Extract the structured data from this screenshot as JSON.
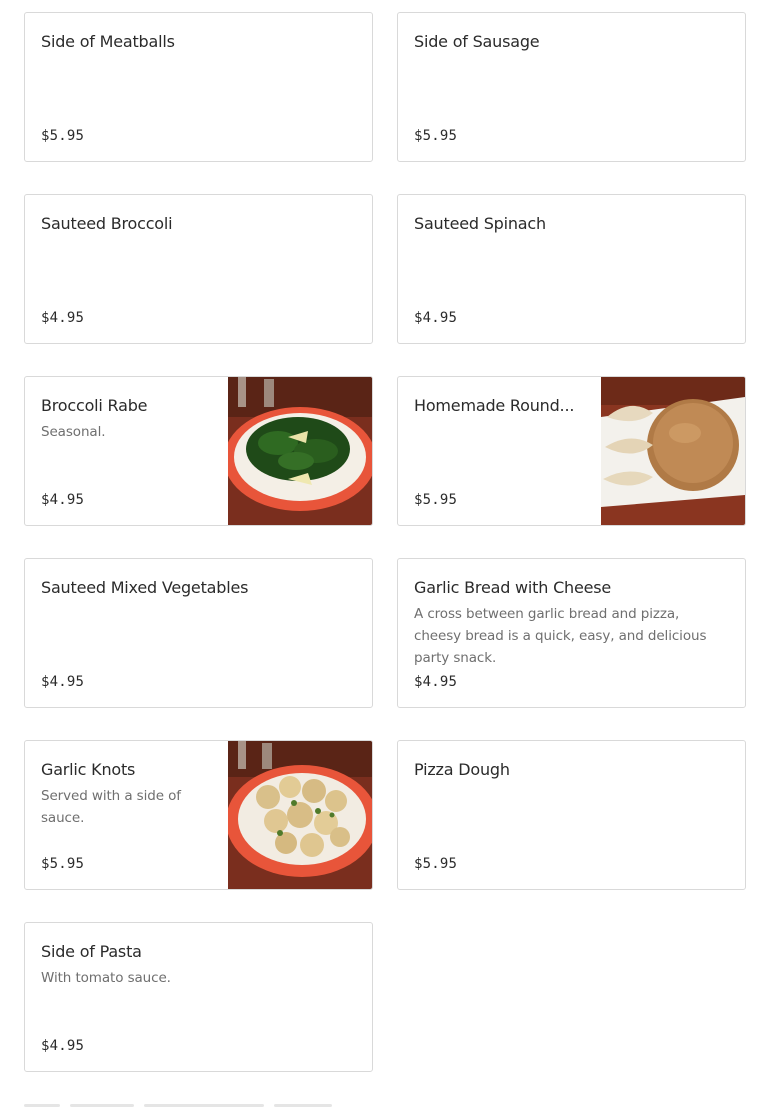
{
  "menu": {
    "items": [
      {
        "title": "Side of Meatballs",
        "description": "",
        "price": "$5.95",
        "image": null
      },
      {
        "title": "Side of Sausage",
        "description": "",
        "price": "$5.95",
        "image": null
      },
      {
        "title": "Sauteed Broccoli",
        "description": "",
        "price": "$4.95",
        "image": null
      },
      {
        "title": "Sauteed Spinach",
        "description": "",
        "price": "$4.95",
        "image": null
      },
      {
        "title": "Broccoli Rabe",
        "description": "Seasonal.",
        "price": "$4.95",
        "image": "broccoli-rabe-photo"
      },
      {
        "title": "Homemade Round...",
        "description": "",
        "price": "$5.95",
        "image": "homemade-round-bread-photo"
      },
      {
        "title": "Sauteed Mixed Vegetables",
        "description": "",
        "price": "$4.95",
        "image": null
      },
      {
        "title": "Garlic Bread with Cheese",
        "description": "A cross between garlic bread and pizza, cheesy bread is a quick, easy, and delicious party snack.",
        "price": "$4.95",
        "image": null
      },
      {
        "title": "Garlic Knots",
        "description": "Served with a side of sauce.",
        "price": "$5.95",
        "image": "garlic-knots-photo"
      },
      {
        "title": "Pizza Dough",
        "description": "",
        "price": "$5.95",
        "image": null
      },
      {
        "title": "Side of Pasta",
        "description": "With tomato sauce.",
        "price": "$4.95",
        "image": null
      }
    ]
  },
  "colors": {
    "card_border": "#d9d9d9",
    "title_text": "#2b2b2b",
    "description_text": "#6f6f6f",
    "plate_rim": "#e8553a",
    "table_wood": "#7a2e1e"
  }
}
